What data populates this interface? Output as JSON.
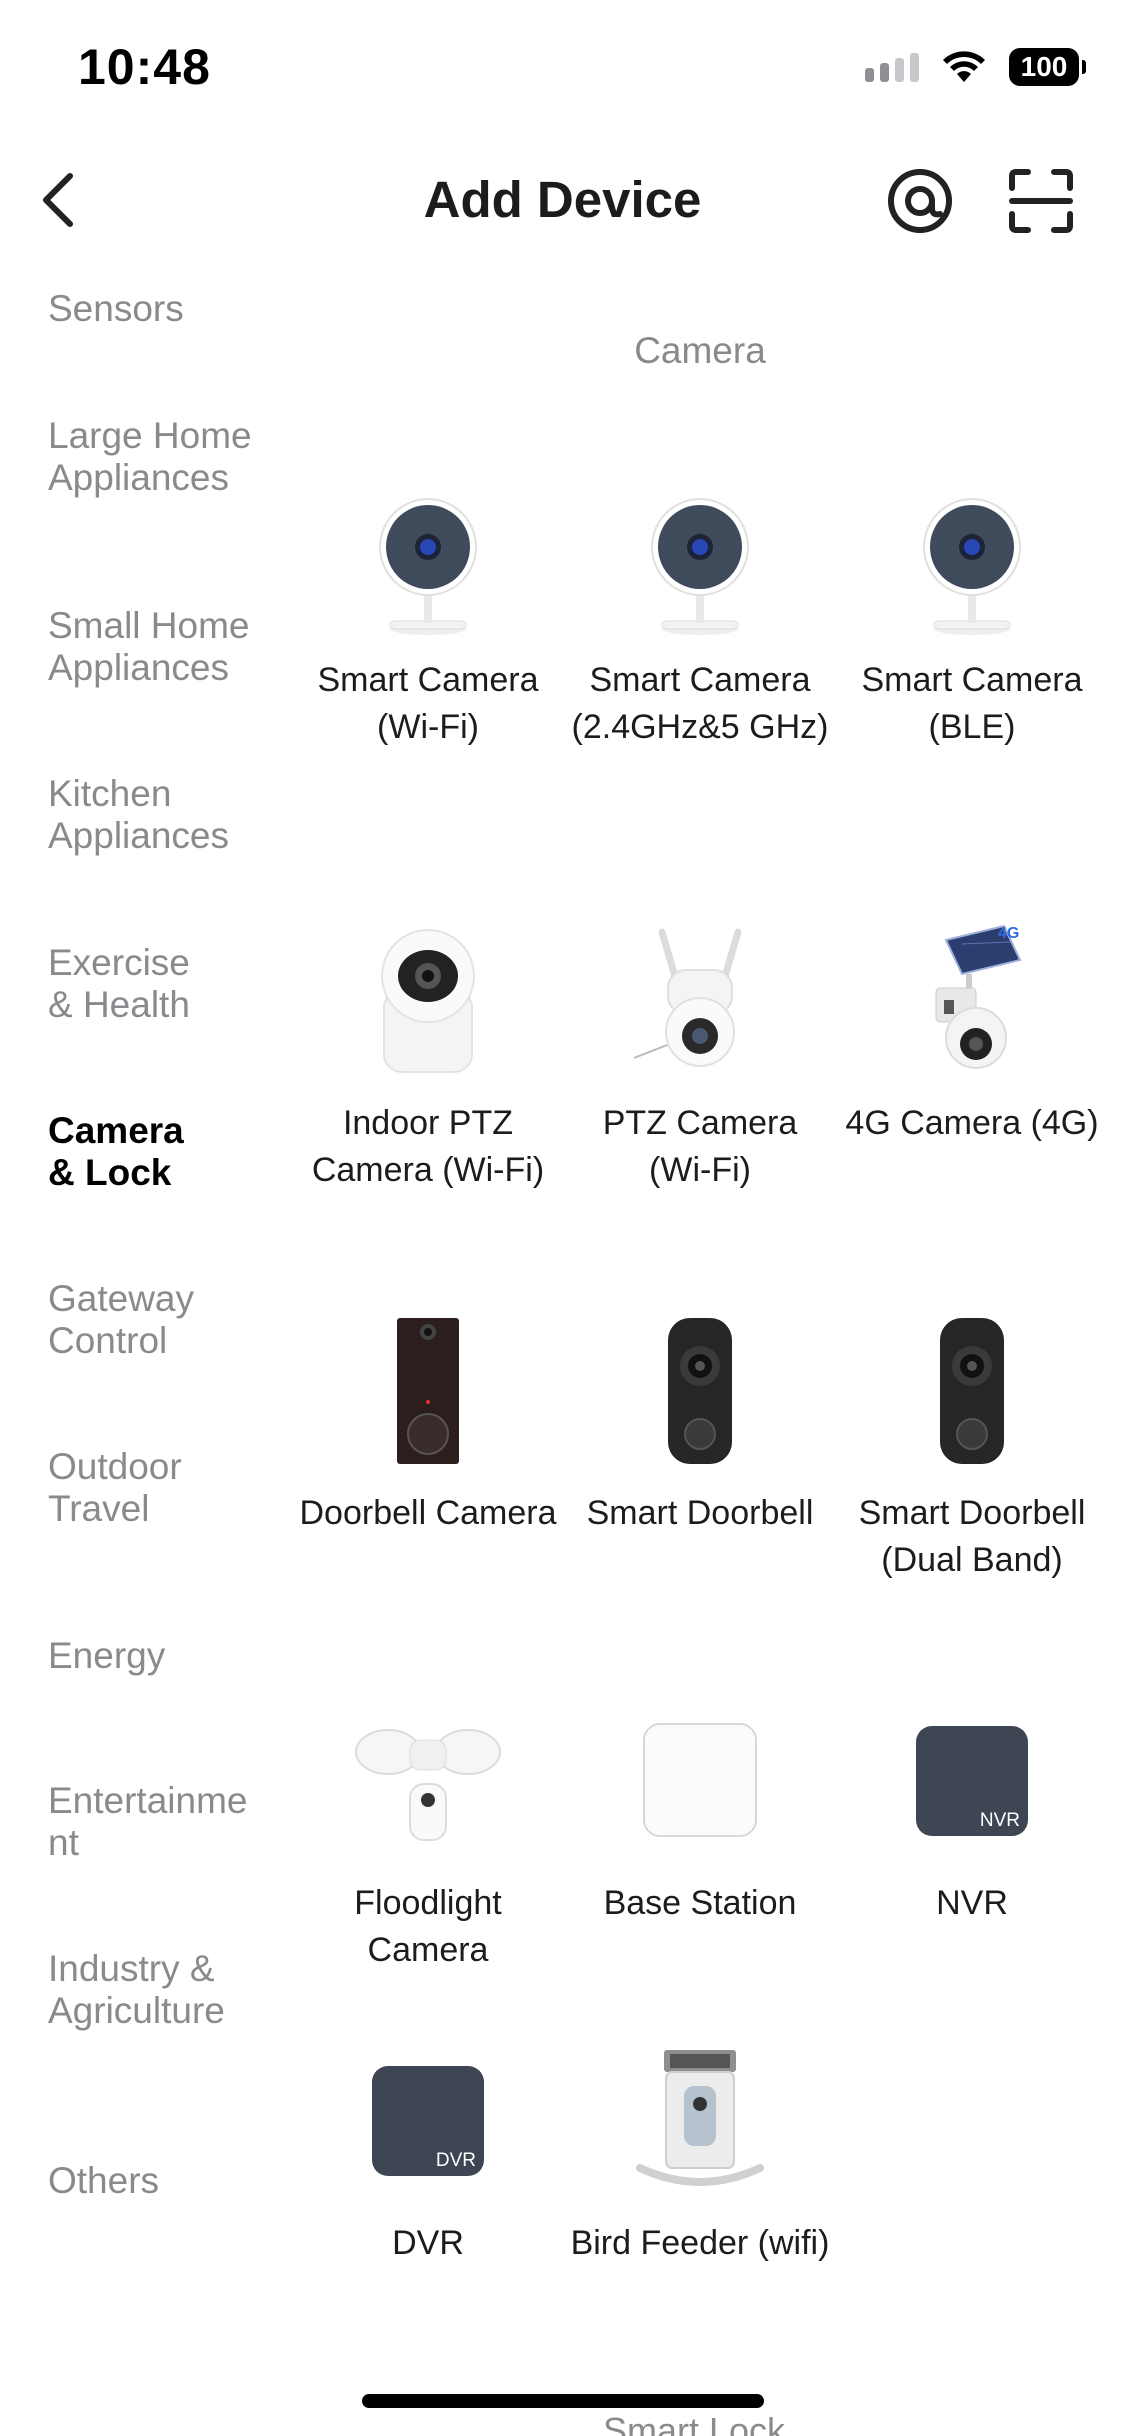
{
  "status_bar": {
    "time": "10:48",
    "battery": "100"
  },
  "header": {
    "title": "Add Device"
  },
  "sidebar": {
    "items": [
      {
        "label": "Sensors"
      },
      {
        "label": "Large Home Appliances"
      },
      {
        "label": "Small Home Appliances"
      },
      {
        "label": "Kitchen Appliances"
      },
      {
        "label": "Exercise & Health"
      },
      {
        "label": "Camera & Lock",
        "active": true
      },
      {
        "label": "Gateway Control"
      },
      {
        "label": "Outdoor Travel"
      },
      {
        "label": "Energy"
      },
      {
        "label": "Entertainment"
      },
      {
        "label": "Industry & Agriculture"
      },
      {
        "label": "Others"
      }
    ]
  },
  "main": {
    "section_title": "Camera",
    "devices": [
      {
        "name": "Smart Camera (Wi-Fi)",
        "icon": "camera-icon"
      },
      {
        "name": "Smart Camera (2.4GHz&5 GHz)",
        "icon": "camera-icon"
      },
      {
        "name": "Smart Camera (BLE)",
        "icon": "camera-icon"
      },
      {
        "name": "Indoor PTZ Camera (Wi-Fi)",
        "icon": "ptz-camera-icon"
      },
      {
        "name": "PTZ Camera (Wi-Fi)",
        "icon": "outdoor-ptz-camera-icon"
      },
      {
        "name": "4G Camera (4G)",
        "icon": "solar-4g-camera-icon"
      },
      {
        "name": "Doorbell Camera",
        "icon": "doorbell-icon"
      },
      {
        "name": "Smart Doorbell",
        "icon": "doorbell-icon"
      },
      {
        "name": "Smart Doorbell (Dual Band)",
        "icon": "doorbell-icon"
      },
      {
        "name": "Floodlight Camera",
        "icon": "floodlight-camera-icon"
      },
      {
        "name": "Base Station",
        "icon": "base-station-icon"
      },
      {
        "name": "NVR",
        "icon": "nvr-icon",
        "badge": "NVR"
      },
      {
        "name": "DVR",
        "icon": "dvr-icon",
        "badge": "DVR"
      },
      {
        "name": "Bird Feeder (wifi)",
        "icon": "bird-feeder-icon"
      }
    ],
    "next_section_peek": "Smart Lock"
  }
}
